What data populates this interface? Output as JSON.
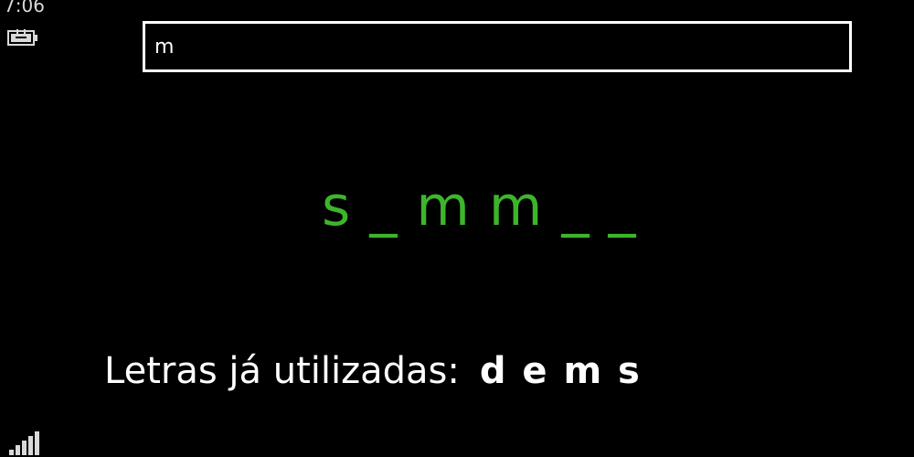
{
  "status_bar": {
    "time": "7:06",
    "battery_icon": "battery-charging-icon",
    "signal_icon": "signal-strength-icon"
  },
  "guess_input": {
    "value": "m"
  },
  "game": {
    "masked_word": "s _ m m _ _",
    "used_letters_label": "Letras já utilizadas:",
    "used_letters": "d e m s"
  },
  "colors": {
    "background": "#000000",
    "word": "#3db52b",
    "text": "#ffffff"
  }
}
